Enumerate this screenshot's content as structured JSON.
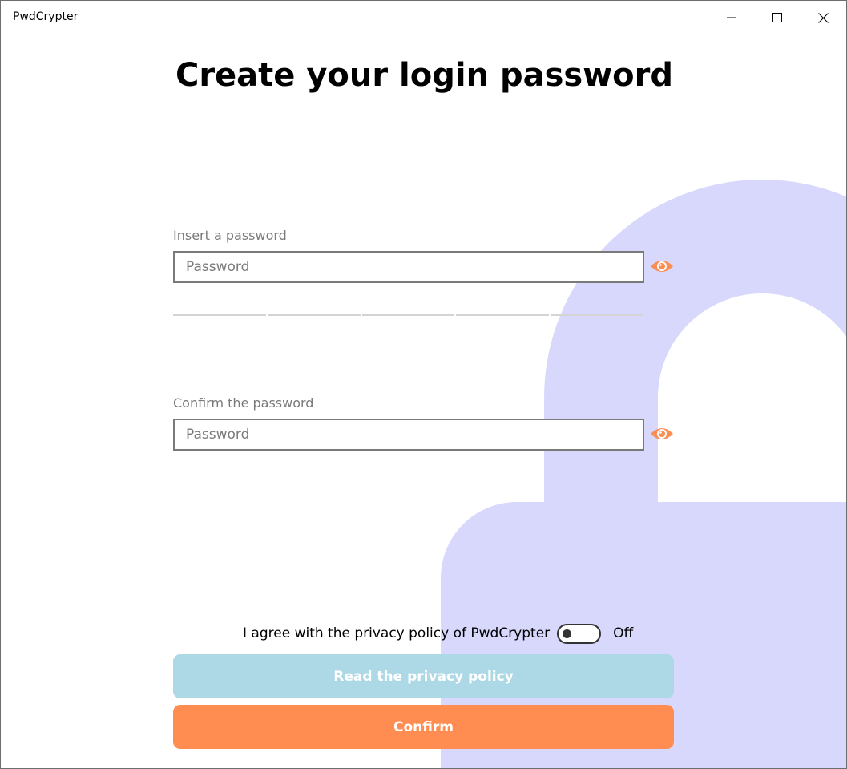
{
  "window": {
    "title": "PwdCrypter",
    "controls": {
      "minimize_icon": "minimize-icon",
      "maximize_icon": "maximize-icon",
      "close_icon": "close-icon"
    }
  },
  "page": {
    "heading": "Create your login password"
  },
  "form": {
    "password": {
      "label": "Insert a password",
      "placeholder": "Password",
      "value": "",
      "reveal_icon": "eye-icon"
    },
    "strength_meter": {
      "segments": 5,
      "level": 0
    },
    "confirm": {
      "label": "Confirm the password",
      "placeholder": "Password",
      "value": "",
      "reveal_icon": "eye-icon"
    }
  },
  "privacy": {
    "agree_text": "I agree with the privacy policy of PwdCrypter",
    "toggle_state": "Off",
    "toggle_on": false
  },
  "buttons": {
    "read_privacy": "Read the privacy policy",
    "confirm": "Confirm"
  },
  "colors": {
    "accent": "#ff8c50",
    "secondary": "#add8e6",
    "lock_background": "#d8d8fc"
  }
}
